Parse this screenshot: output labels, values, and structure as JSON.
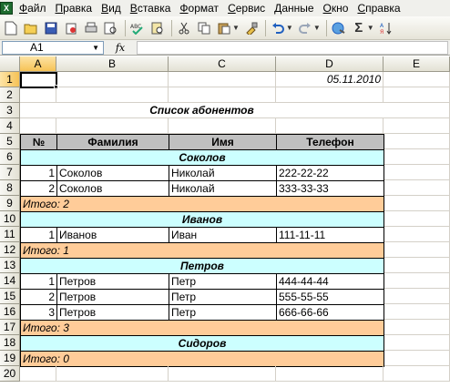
{
  "menu": {
    "items": [
      "Файл",
      "Правка",
      "Вид",
      "Вставка",
      "Формат",
      "Сервис",
      "Данные",
      "Окно",
      "Справка"
    ]
  },
  "toolbar": {
    "buttons": [
      "new-icon",
      "open-icon",
      "save-icon",
      "permission-icon",
      "print-icon",
      "print-preview-icon",
      "spelling-icon",
      "research-icon",
      "cut-icon",
      "copy-icon",
      "paste-icon",
      "format-painter-icon",
      "undo-icon",
      "redo-icon",
      "hyperlink-icon",
      "autosum-icon",
      "sort-icon"
    ]
  },
  "formula_bar": {
    "name_box": "A1",
    "fx_label": "fx",
    "formula": ""
  },
  "columns": [
    "A",
    "B",
    "C",
    "D",
    "E"
  ],
  "rows": [
    "1",
    "2",
    "3",
    "4",
    "5",
    "6",
    "7",
    "8",
    "9",
    "10",
    "11",
    "12",
    "13",
    "14",
    "15",
    "16",
    "17",
    "18",
    "19",
    "20"
  ],
  "sheet": {
    "date": "05.11.2010",
    "title": "Список абонентов",
    "headers": [
      "№",
      "Фамилия",
      "Имя",
      "Телефон"
    ],
    "groups": [
      {
        "name": "Соколов",
        "rows": [
          [
            "1",
            "Соколов",
            "Николай",
            "222-22-22"
          ],
          [
            "2",
            "Соколов",
            "Николай",
            "333-33-33"
          ]
        ],
        "total": "Итого: 2"
      },
      {
        "name": "Иванов",
        "rows": [
          [
            "1",
            "Иванов",
            "Иван",
            "111-11-11"
          ]
        ],
        "total": "Итого: 1"
      },
      {
        "name": "Петров",
        "rows": [
          [
            "1",
            "Петров",
            "Петр",
            "444-44-44"
          ],
          [
            "2",
            "Петров",
            "Петр",
            "555-55-55"
          ],
          [
            "3",
            "Петров",
            "Петр",
            "666-66-66"
          ]
        ],
        "total": "Итого: 3"
      },
      {
        "name": "Сидоров",
        "rows": [],
        "total": "Итого: 0"
      }
    ]
  },
  "colors": {
    "group_fill": "#ccffff",
    "total_fill": "#ffcc99",
    "header_fill": "#c0c0c0",
    "selection_header": "#f6c255"
  }
}
